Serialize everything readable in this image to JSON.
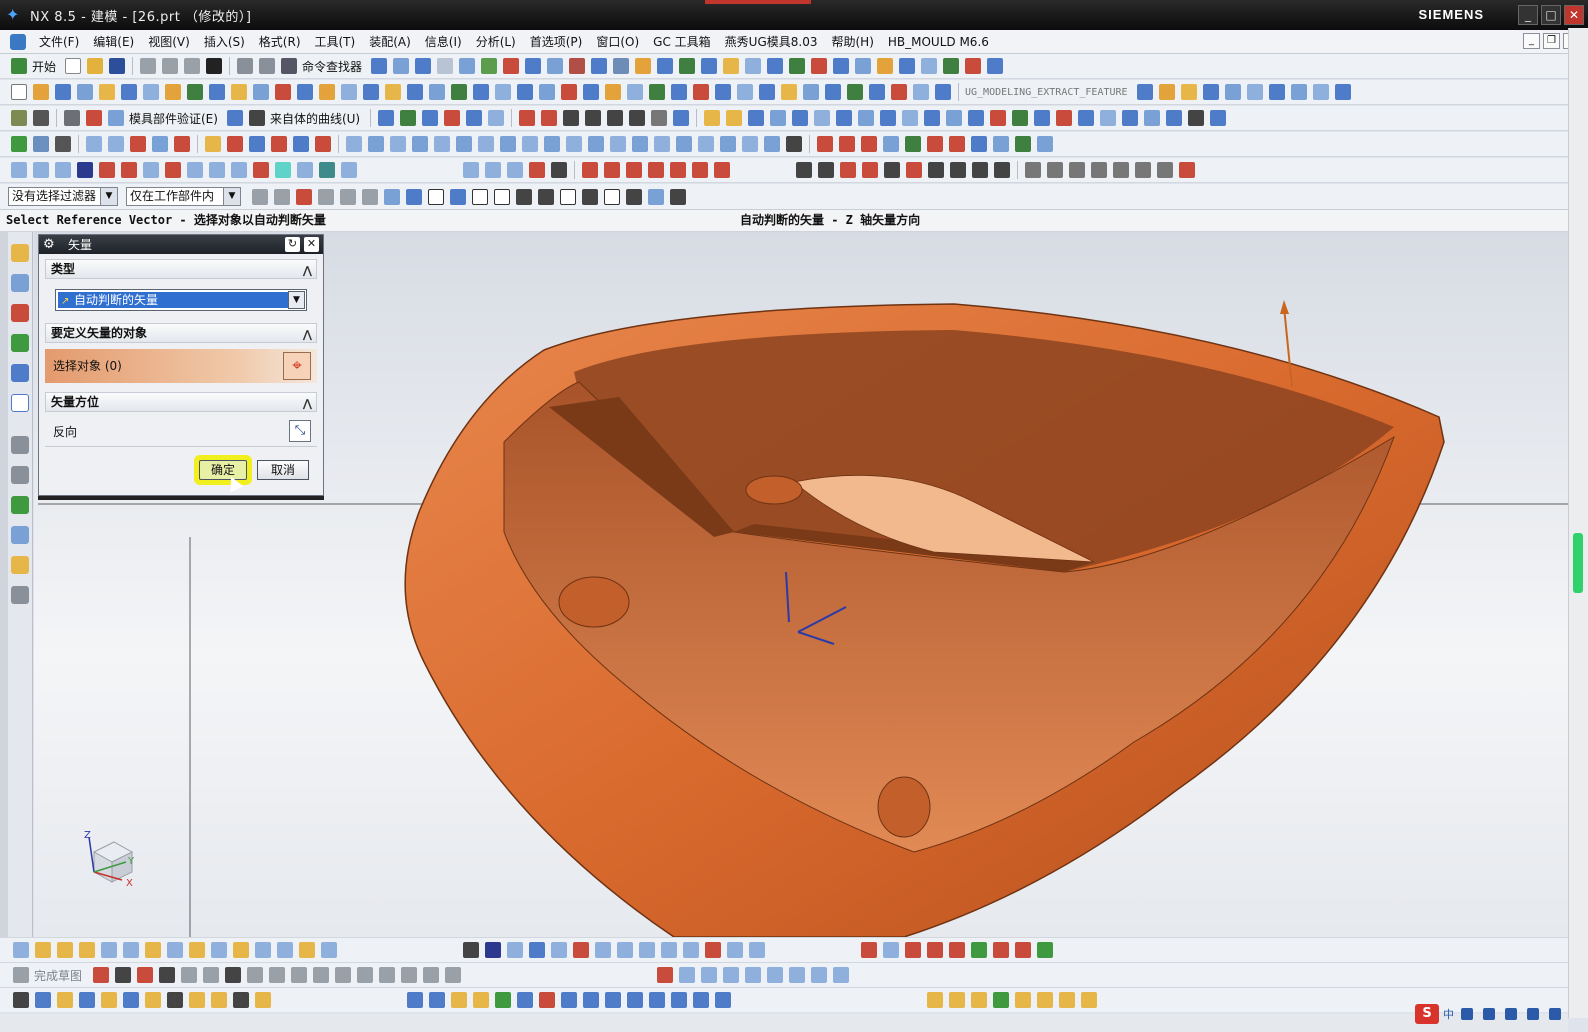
{
  "window": {
    "title": "NX 8.5 - 建模 - [26.prt （修改的）]",
    "brand": "SIEMENS"
  },
  "menu": [
    "文件(F)",
    "编辑(E)",
    "视图(V)",
    "插入(S)",
    "格式(R)",
    "工具(T)",
    "装配(A)",
    "信息(I)",
    "分析(L)",
    "首选项(P)",
    "窗口(O)",
    "GC 工具箱",
    "燕秀UG模具8.03",
    "帮助(H)",
    "HB_MOULD M6.6"
  ],
  "toolbar": {
    "start_label": "开始",
    "command_finder": "命令查找器",
    "extract_feature": "UG_MODELING_EXTRACT_FEATURE",
    "mold_validate": "模具部件验证(E)",
    "curve_from_body": "来自体的曲线(U)",
    "finish_sketch": "完成草图"
  },
  "filters": {
    "type_filter": "没有选择过滤器",
    "scope_filter": "仅在工作部件内"
  },
  "status": {
    "prompt": "Select Reference Vector - 选择对象以自动判断矢量",
    "info": "自动判断的矢量 - Z 轴矢量方向"
  },
  "dialog": {
    "title": "矢量",
    "section_type": "类型",
    "type_value": "自动判断的矢量",
    "section_object": "要定义矢量的对象",
    "select_object": "选择对象 (0)",
    "section_orientation": "矢量方位",
    "reverse": "反向",
    "ok": "确定",
    "cancel": "取消"
  },
  "tray": {
    "ime": "S",
    "lang": "中"
  },
  "colors": {
    "part": "#d9682f",
    "accent": "#2f6fd0",
    "ok_highlight": "#f2ef1f",
    "title_bg": "#141414"
  },
  "triad": {
    "x": "X",
    "y": "Y",
    "z": "Z"
  }
}
